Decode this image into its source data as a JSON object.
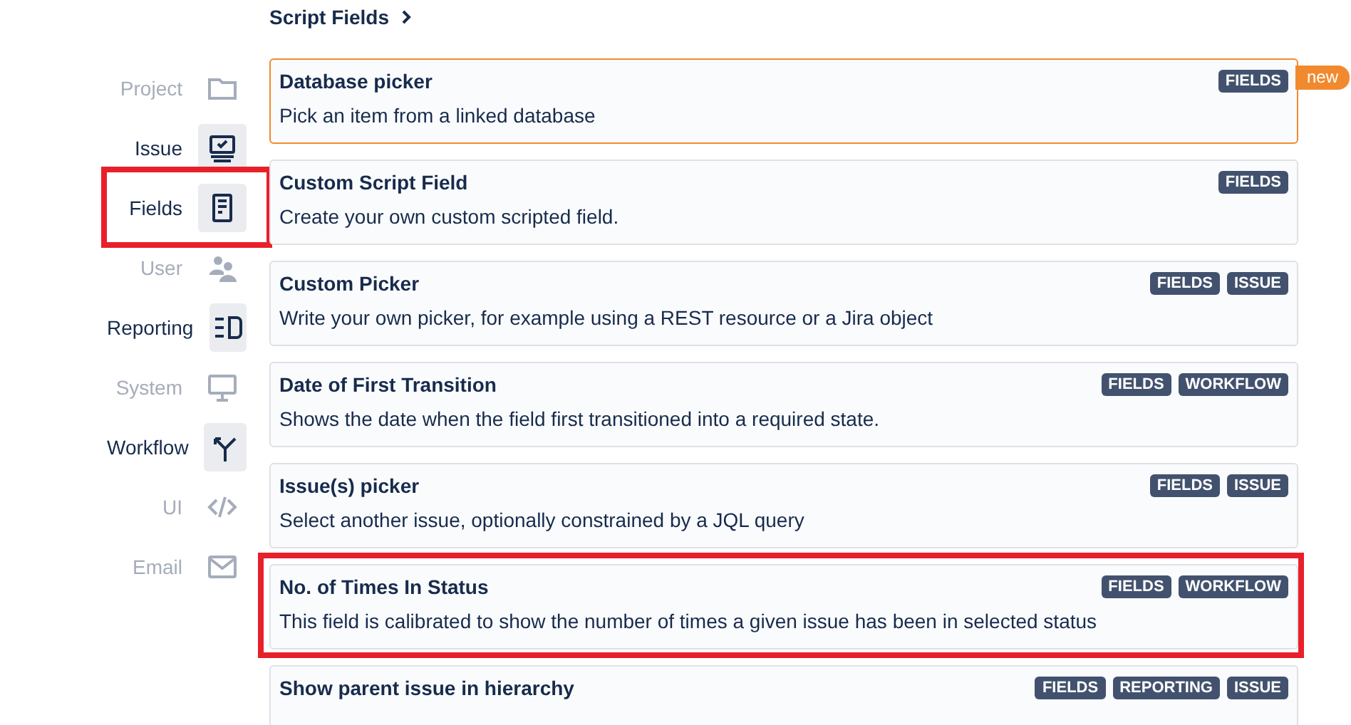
{
  "breadcrumb": {
    "label": "Script Fields"
  },
  "sidebar": {
    "items": [
      {
        "label": "Project",
        "enabled": false,
        "highlighted": false
      },
      {
        "label": "Issue",
        "enabled": true,
        "highlighted": false
      },
      {
        "label": "Fields",
        "enabled": true,
        "highlighted": true
      },
      {
        "label": "User",
        "enabled": false,
        "highlighted": false
      },
      {
        "label": "Reporting",
        "enabled": true,
        "highlighted": false
      },
      {
        "label": "System",
        "enabled": false,
        "highlighted": false
      },
      {
        "label": "Workflow",
        "enabled": true,
        "highlighted": false
      },
      {
        "label": "UI",
        "enabled": false,
        "highlighted": false
      },
      {
        "label": "Email",
        "enabled": false,
        "highlighted": false
      }
    ]
  },
  "cards": [
    {
      "title": "Database picker",
      "description": "Pick an item from a linked database",
      "tags": [
        "FIELDS"
      ],
      "badge": "new",
      "selected": true,
      "highlighted": false
    },
    {
      "title": "Custom Script Field",
      "description": "Create your own custom scripted field.",
      "tags": [
        "FIELDS"
      ],
      "selected": false,
      "highlighted": false
    },
    {
      "title": "Custom Picker",
      "description": "Write your own picker, for example using a REST resource or a Jira object",
      "tags": [
        "FIELDS",
        "ISSUE"
      ],
      "selected": false,
      "highlighted": false
    },
    {
      "title": "Date of First Transition",
      "description": "Shows the date when the field first transitioned into a required state.",
      "tags": [
        "FIELDS",
        "WORKFLOW"
      ],
      "selected": false,
      "highlighted": false
    },
    {
      "title": "Issue(s) picker",
      "description": "Select another issue, optionally constrained by a JQL query",
      "tags": [
        "FIELDS",
        "ISSUE"
      ],
      "selected": false,
      "highlighted": false
    },
    {
      "title": "No. of Times In Status",
      "description": "This field is calibrated to show the number of times a given issue has been in selected status",
      "tags": [
        "FIELDS",
        "WORKFLOW"
      ],
      "selected": false,
      "highlighted": true
    },
    {
      "title": "Show parent issue in hierarchy",
      "tags": [
        "FIELDS",
        "REPORTING",
        "ISSUE"
      ],
      "selected": false,
      "highlighted": false
    }
  ]
}
